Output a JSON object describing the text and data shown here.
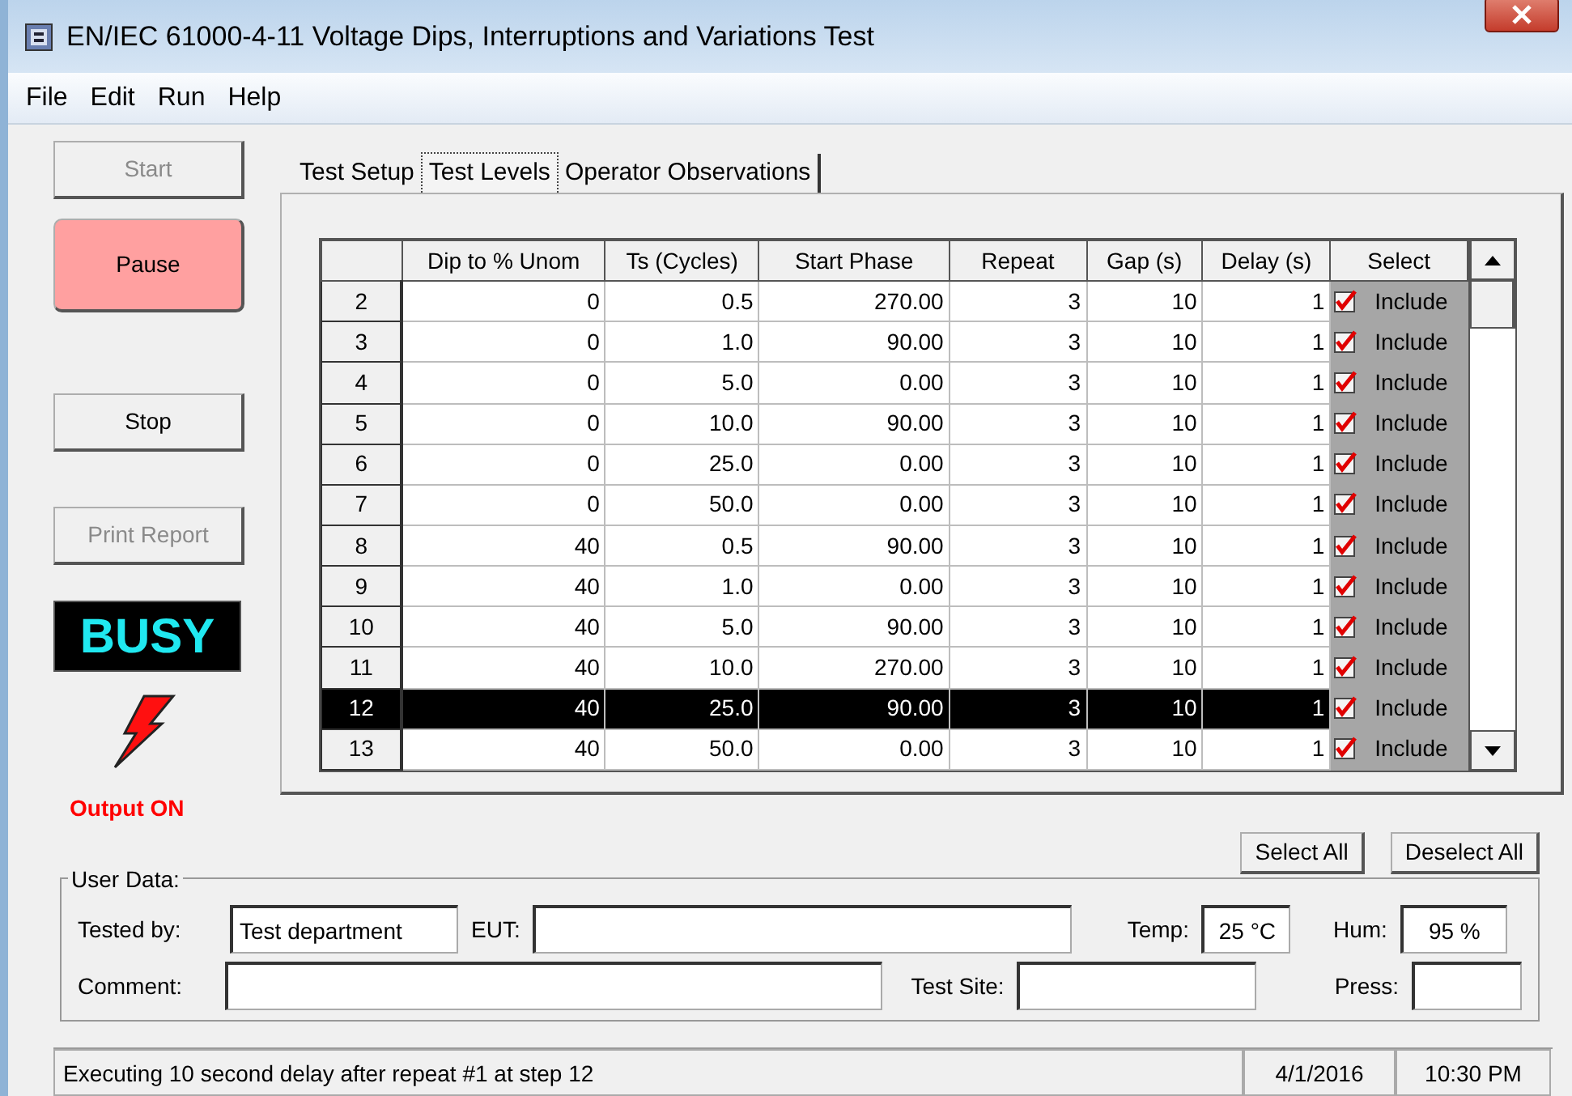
{
  "window": {
    "title": "EN/IEC 61000-4-11 Voltage Dips, Interruptions and Variations Test"
  },
  "menu": [
    "File",
    "Edit",
    "Run",
    "Help"
  ],
  "side_buttons": [
    {
      "label": "Start",
      "kind": "normal",
      "disabled": true
    },
    {
      "label": "Pause",
      "kind": "alert",
      "disabled": false
    },
    {
      "label": "Stop",
      "kind": "normal",
      "disabled": false
    },
    {
      "label": "Print Report",
      "kind": "normal",
      "disabled": true
    }
  ],
  "indicator": {
    "busy": "BUSY",
    "output": "Output ON",
    "output_on": true
  },
  "tabs": [
    {
      "label": "Test Setup",
      "selected": false
    },
    {
      "label": "Test Levels",
      "selected": true
    },
    {
      "label": "Operator Observations",
      "selected": false
    }
  ],
  "table": {
    "columns": [
      "Dip to % Unom",
      "Ts (Cycles)",
      "Start Phase",
      "Repeat",
      "Gap (s)",
      "Delay (s)",
      "Select"
    ],
    "rows": [
      {
        "step": "2",
        "values": [
          "0",
          "0.5",
          "270.00",
          "3",
          "10",
          "1"
        ],
        "include": {
          "label": "Include",
          "checked": true
        },
        "selected": false
      },
      {
        "step": "3",
        "values": [
          "0",
          "1.0",
          "90.00",
          "3",
          "10",
          "1"
        ],
        "include": {
          "label": "Include",
          "checked": true
        },
        "selected": false
      },
      {
        "step": "4",
        "values": [
          "0",
          "5.0",
          "0.00",
          "3",
          "10",
          "1"
        ],
        "include": {
          "label": "Include",
          "checked": true
        },
        "selected": false
      },
      {
        "step": "5",
        "values": [
          "0",
          "10.0",
          "90.00",
          "3",
          "10",
          "1"
        ],
        "include": {
          "label": "Include",
          "checked": true
        },
        "selected": false
      },
      {
        "step": "6",
        "values": [
          "0",
          "25.0",
          "0.00",
          "3",
          "10",
          "1"
        ],
        "include": {
          "label": "Include",
          "checked": true
        },
        "selected": false
      },
      {
        "step": "7",
        "values": [
          "0",
          "50.0",
          "0.00",
          "3",
          "10",
          "1"
        ],
        "include": {
          "label": "Include",
          "checked": true
        },
        "selected": false
      },
      {
        "step": "8",
        "values": [
          "40",
          "0.5",
          "90.00",
          "3",
          "10",
          "1"
        ],
        "include": {
          "label": "Include",
          "checked": true
        },
        "selected": false
      },
      {
        "step": "9",
        "values": [
          "40",
          "1.0",
          "0.00",
          "3",
          "10",
          "1"
        ],
        "include": {
          "label": "Include",
          "checked": true
        },
        "selected": false
      },
      {
        "step": "10",
        "values": [
          "40",
          "5.0",
          "90.00",
          "3",
          "10",
          "1"
        ],
        "include": {
          "label": "Include",
          "checked": true
        },
        "selected": false
      },
      {
        "step": "11",
        "values": [
          "40",
          "10.0",
          "270.00",
          "3",
          "10",
          "1"
        ],
        "include": {
          "label": "Include",
          "checked": true
        },
        "selected": false
      },
      {
        "step": "12",
        "values": [
          "40",
          "25.0",
          "90.00",
          "3",
          "10",
          "1"
        ],
        "include": {
          "label": "Include",
          "checked": true
        },
        "selected": true
      },
      {
        "step": "13",
        "values": [
          "40",
          "50.0",
          "0.00",
          "3",
          "10",
          "1"
        ],
        "include": {
          "label": "Include",
          "checked": true
        },
        "selected": false
      }
    ]
  },
  "selection_buttons": [
    "Select All",
    "Deselect All"
  ],
  "user_data": {
    "legend": "User Data:",
    "fields": [
      {
        "label": "Tested by:",
        "value": "Test department"
      },
      {
        "label": "EUT:",
        "new_line": false
      },
      {
        "label": "Temp:",
        "value": "25 °C",
        "new_line": false
      },
      {
        "label": "Hum:",
        "value": "95 %",
        "new_line": false
      },
      {
        "label": "Comment:",
        "new_line": true
      },
      {
        "label": "Test Site:",
        "new_line": false
      },
      {
        "label": "Press:",
        "new_line": false
      }
    ]
  },
  "status_bar": {
    "message": "Executing 10 second delay after repeat #1 at step 12",
    "date": "4/1/2016",
    "time": "10:30 PM"
  }
}
